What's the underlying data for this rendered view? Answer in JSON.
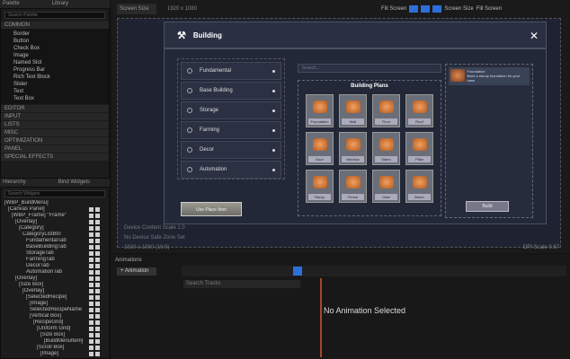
{
  "palette": {
    "tabs": [
      "Palette",
      "Library"
    ],
    "search_placeholder": "Search Palette",
    "sections": [
      "COMMON",
      "EDITOR",
      "INPUT",
      "LISTS",
      "MISC",
      "OPTIMIZATION",
      "PANEL",
      "SPECIAL EFFECTS"
    ],
    "common_items": [
      "Border",
      "Button",
      "Check Box",
      "Image",
      "Named Slot",
      "Progress Bar",
      "Rich Text Block",
      "Slider",
      "Text",
      "Text Box"
    ]
  },
  "hierarchy": {
    "tabs": [
      "Hierarchy",
      "Bind Widgets"
    ],
    "search_placeholder": "Search Widgets",
    "items": [
      "[WBP_BuildMenu]",
      "[Canvas Panel]",
      "[WBP_Frame] \"Frame\"",
      "[Overlay]",
      "[Category]",
      "CategoryListBtn",
      "FundamentalTab",
      "BaseBuildingTab",
      "StorageTab",
      "FarmingTab",
      "DecorTab",
      "AutomationTab",
      "[Overlay]",
      "[Size Box]",
      "[Overlay]",
      "[SelectedRecipe]",
      "[Image]",
      "SelectedRecipeName",
      "[Vertical Box]",
      "[RecipeGrid]",
      "[Uniform Grid]",
      "[Size Box]",
      "[BuildMenuItem]",
      "[Scroll Box]",
      "[Image]"
    ]
  },
  "toolbar": {
    "screen_size": "Screen Size",
    "resolution": "1920 x 1080",
    "fill": "Fill Screen",
    "dropdowns": [
      "Screen Size",
      "Fill Screen"
    ]
  },
  "canvas": {
    "device_scale": "Device Content Scale 1.0",
    "safe_zone": "No Device Safe Zone Set",
    "resolution_info": "1920 x 1080 (16:9)",
    "dpi": "DPI Scale 0.67"
  },
  "dialog": {
    "title": "Building",
    "close": "✕",
    "categories": [
      "Fundamental",
      "Base Building",
      "Storage",
      "Farming",
      "Decor",
      "Automation"
    ],
    "use_button": "Use Place Item",
    "search_placeholder": "Search...",
    "grid_title": "Building Plans",
    "items": [
      "Foundation",
      "Wall",
      "Floor",
      "Roof",
      "Door",
      "Window",
      "Stairs",
      "Pillar",
      "Ramp",
      "Fence",
      "Gate",
      "Beam"
    ],
    "info_title": "Foundation",
    "info_desc": "Build a sturdy foundation for your base.",
    "craft_button": "Build"
  },
  "animations": {
    "tab": "Animations",
    "add": "+ Animation",
    "empty": "No Animation Selected",
    "search": "Search Tracks"
  }
}
